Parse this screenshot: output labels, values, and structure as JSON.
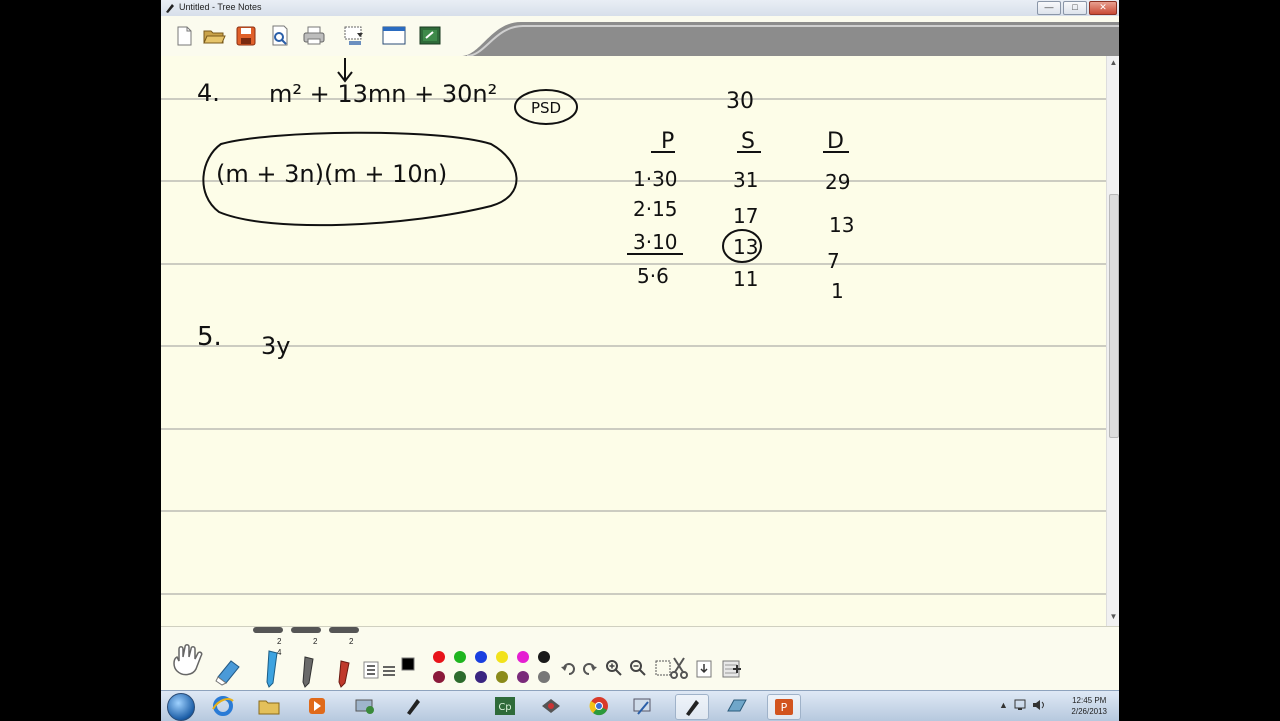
{
  "window": {
    "title": "Untitled - Tree Notes",
    "minimize_glyph": "—",
    "maximize_glyph": "□",
    "close_glyph": "✕"
  },
  "toolbar": {
    "icons": [
      "new-page-icon",
      "open-folder-icon",
      "save-icon",
      "print-preview-icon",
      "print-icon",
      "capture-icon",
      "window-view-icon",
      "whiteboard-icon"
    ]
  },
  "note": {
    "problem4": {
      "number": "4.",
      "expression": "m² + 13mn + 30n²",
      "tag": "PSD",
      "answer": "(m + 3n)(m + 10n)",
      "target": "30",
      "headers": [
        "P",
        "S",
        "D"
      ],
      "rows": [
        [
          "1·30",
          "31",
          "29"
        ],
        [
          "2·15",
          "17",
          "13"
        ],
        [
          "3·10",
          "13",
          "7"
        ],
        [
          "5·6",
          "11",
          "1"
        ]
      ]
    },
    "problem5": {
      "number": "5.",
      "partial": "3y"
    }
  },
  "palette": {
    "pen_numbers": [
      "2",
      "2",
      "2"
    ],
    "pen_sub": "4",
    "colors_row1": [
      "#e8141a",
      "#1fb51f",
      "#1a3fe0",
      "#f2e21b",
      "#e51fd2",
      "#1a1a1a"
    ],
    "colors_row2": [
      "#8b1a3a",
      "#2d6b2d",
      "#3a2580",
      "#8a8a1a",
      "#7a2a7a",
      "#777777"
    ]
  },
  "taskbar": {
    "clock_time": "12:45 PM",
    "clock_date": "2/26/2013"
  }
}
